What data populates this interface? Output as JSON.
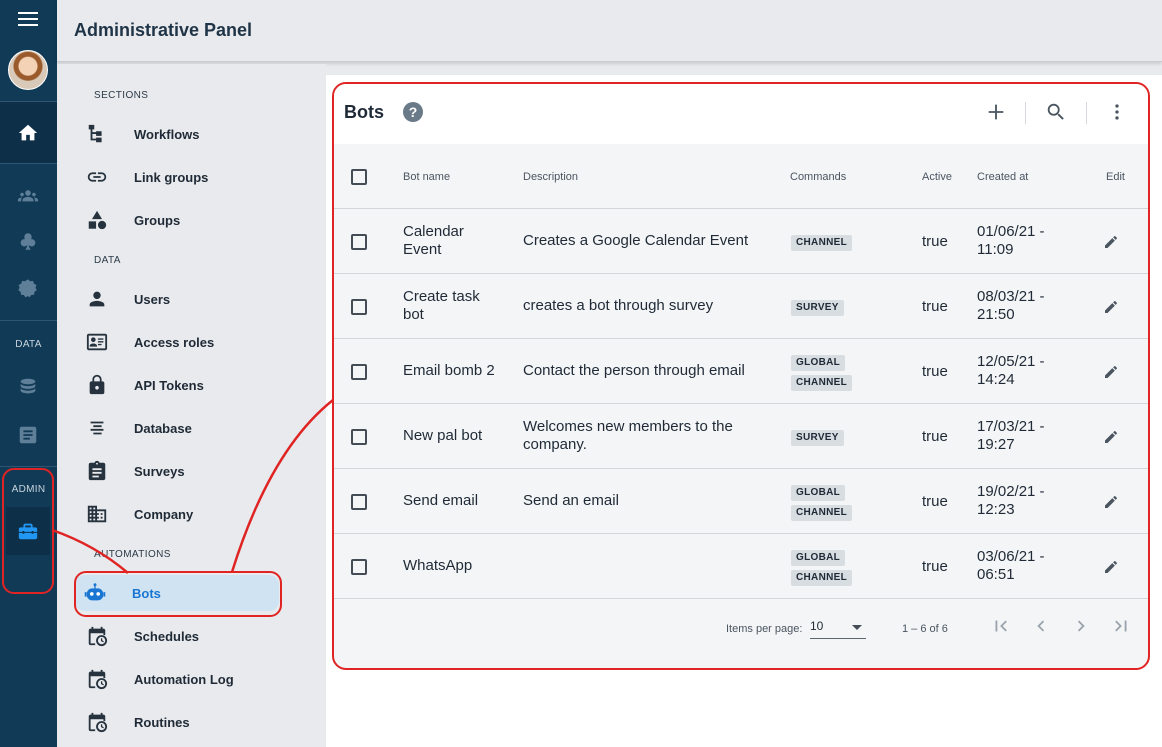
{
  "header": {
    "title": "Administrative Panel"
  },
  "rail": {
    "data_label": "DATA",
    "admin_label": "ADMIN"
  },
  "nav": {
    "sections_label": "SECTIONS",
    "data_label": "DATA",
    "automations_label": "AUTOMATIONS",
    "items": [
      {
        "label": "Workflows"
      },
      {
        "label": "Link groups"
      },
      {
        "label": "Groups"
      },
      {
        "label": "Users"
      },
      {
        "label": "Access roles"
      },
      {
        "label": "API Tokens"
      },
      {
        "label": "Database"
      },
      {
        "label": "Surveys"
      },
      {
        "label": "Company"
      },
      {
        "label": "Bots"
      },
      {
        "label": "Schedules"
      },
      {
        "label": "Automation Log"
      },
      {
        "label": "Routines"
      }
    ]
  },
  "card": {
    "title": "Bots",
    "help": "?",
    "columns": {
      "name": "Bot name",
      "description": "Description",
      "commands": "Commands",
      "active": "Active",
      "created": "Created at",
      "edit": "Edit"
    },
    "rows": [
      {
        "name1": "Calendar",
        "name2": "Event",
        "description1": "Creates a Google Calendar Event",
        "description2": "",
        "chip1": "CHANNEL",
        "chip2": "",
        "active": "true",
        "created1": "01/06/21 -",
        "created2": "11:09"
      },
      {
        "name1": "Create task",
        "name2": "bot",
        "description1": "creates a bot through survey",
        "description2": "",
        "chip1": "SURVEY",
        "chip2": "",
        "active": "true",
        "created1": "08/03/21 -",
        "created2": "21:50"
      },
      {
        "name1": "Email bomb 2",
        "name2": "",
        "description1": "Contact the person through email",
        "description2": "",
        "chip1": "GLOBAL",
        "chip2": "CHANNEL",
        "active": "true",
        "created1": "12/05/21 -",
        "created2": "14:24"
      },
      {
        "name1": "New pal bot",
        "name2": "",
        "description1": "Welcomes new members to the",
        "description2": "company.",
        "chip1": "SURVEY",
        "chip2": "",
        "active": "true",
        "created1": "17/03/21 -",
        "created2": "19:27"
      },
      {
        "name1": "Send email",
        "name2": "",
        "description1": "Send an email",
        "description2": "",
        "chip1": "GLOBAL",
        "chip2": "CHANNEL",
        "active": "true",
        "created1": "19/02/21 -",
        "created2": "12:23"
      },
      {
        "name1": "WhatsApp",
        "name2": "",
        "description1": "",
        "description2": "",
        "chip1": "GLOBAL",
        "chip2": "CHANNEL",
        "active": "true",
        "created1": "03/06/21 -",
        "created2": "06:51"
      }
    ],
    "footer": {
      "items_per_page_label": "Items per page:",
      "items_per_page_value": "10",
      "range": "1 – 6 of 6"
    }
  },
  "colors": {
    "accent": "#1976d2",
    "rail": "#103a56",
    "annotation": "#e02424"
  }
}
